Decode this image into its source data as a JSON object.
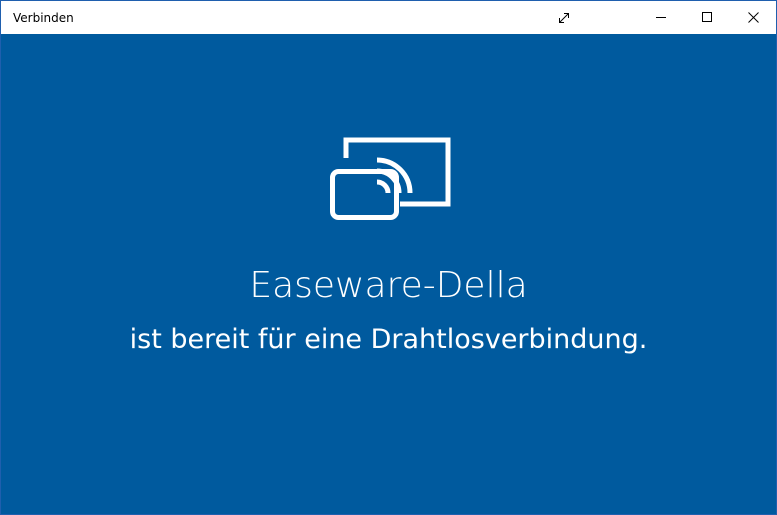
{
  "window": {
    "title": "Verbinden"
  },
  "titlebar": {
    "buttons": {
      "expand_icon": "expand-arrows-icon",
      "minimize_icon": "minimize-icon",
      "maximize_icon": "maximize-icon",
      "close_icon": "close-icon"
    }
  },
  "main": {
    "icon": "wireless-display-cast-icon",
    "device_name": "Easeware-Della",
    "status": "ist bereit für eine Drahtlosverbindung."
  },
  "colors": {
    "background": "#005a9e",
    "titlebar": "#ffffff",
    "text": "#ffffff"
  }
}
